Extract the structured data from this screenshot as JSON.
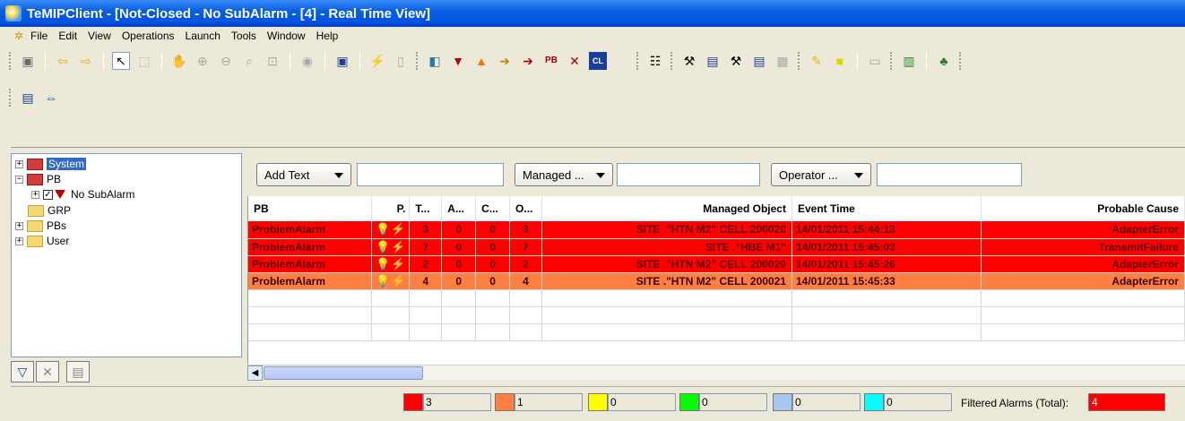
{
  "window": {
    "title": "TeMIPClient - [Not-Closed - No SubAlarm - [4] - Real Time View]"
  },
  "menu": [
    "File",
    "Edit",
    "View",
    "Operations",
    "Launch",
    "Tools",
    "Window",
    "Help"
  ],
  "tree": {
    "items": [
      {
        "label": "System"
      },
      {
        "label": "PB"
      },
      {
        "label": "No SubAlarm"
      },
      {
        "label": "GRP"
      },
      {
        "label": "PBs"
      },
      {
        "label": "User"
      }
    ]
  },
  "filters": {
    "add_text": "Add Text",
    "managed": "Managed ...",
    "operator": "Operator ..."
  },
  "table": {
    "columns": [
      "PB",
      "P.",
      "T...",
      "A...",
      "C...",
      "O...",
      "Managed Object",
      "Event Time",
      "Probable Cause"
    ],
    "rows": [
      {
        "pb": "ProblemAlarm",
        "t": "3",
        "a": "0",
        "c": "0",
        "o": "3",
        "mo": "SITE .\"HTN M2\" CELL 200020",
        "time": "14/01/2011 15:44:13",
        "cause": "AdapterError",
        "color": "red"
      },
      {
        "pb": "ProblemAlarm",
        "t": "7",
        "a": "0",
        "c": "0",
        "o": "7",
        "mo": "SITE .\"HBE M1\"",
        "time": "14/01/2011 15:45:03",
        "cause": "TransmitFailure",
        "color": "red"
      },
      {
        "pb": "ProblemAlarm",
        "t": "2",
        "a": "0",
        "c": "0",
        "o": "2",
        "mo": "SITE .\"HTN M2\" CELL 200020",
        "time": "14/01/2011 15:45:26",
        "cause": "AdapterError",
        "color": "red"
      },
      {
        "pb": "ProblemAlarm",
        "t": "4",
        "a": "0",
        "c": "0",
        "o": "4",
        "mo": "SITE .\"HTN M2\" CELL 200021",
        "time": "14/01/2011 15:45:33",
        "cause": "AdapterError",
        "color": "orange"
      }
    ]
  },
  "status": {
    "counts": [
      {
        "color": "#ff0000",
        "value": "3"
      },
      {
        "color": "#ff7f40",
        "value": "1"
      },
      {
        "color": "#ffff00",
        "value": "0"
      },
      {
        "color": "#00ff00",
        "value": "0"
      },
      {
        "color": "#a6c8f0",
        "value": "0"
      },
      {
        "color": "#00ffff",
        "value": "0"
      }
    ],
    "filtered_label": "Filtered Alarms (Total):",
    "filtered_total": "4"
  }
}
